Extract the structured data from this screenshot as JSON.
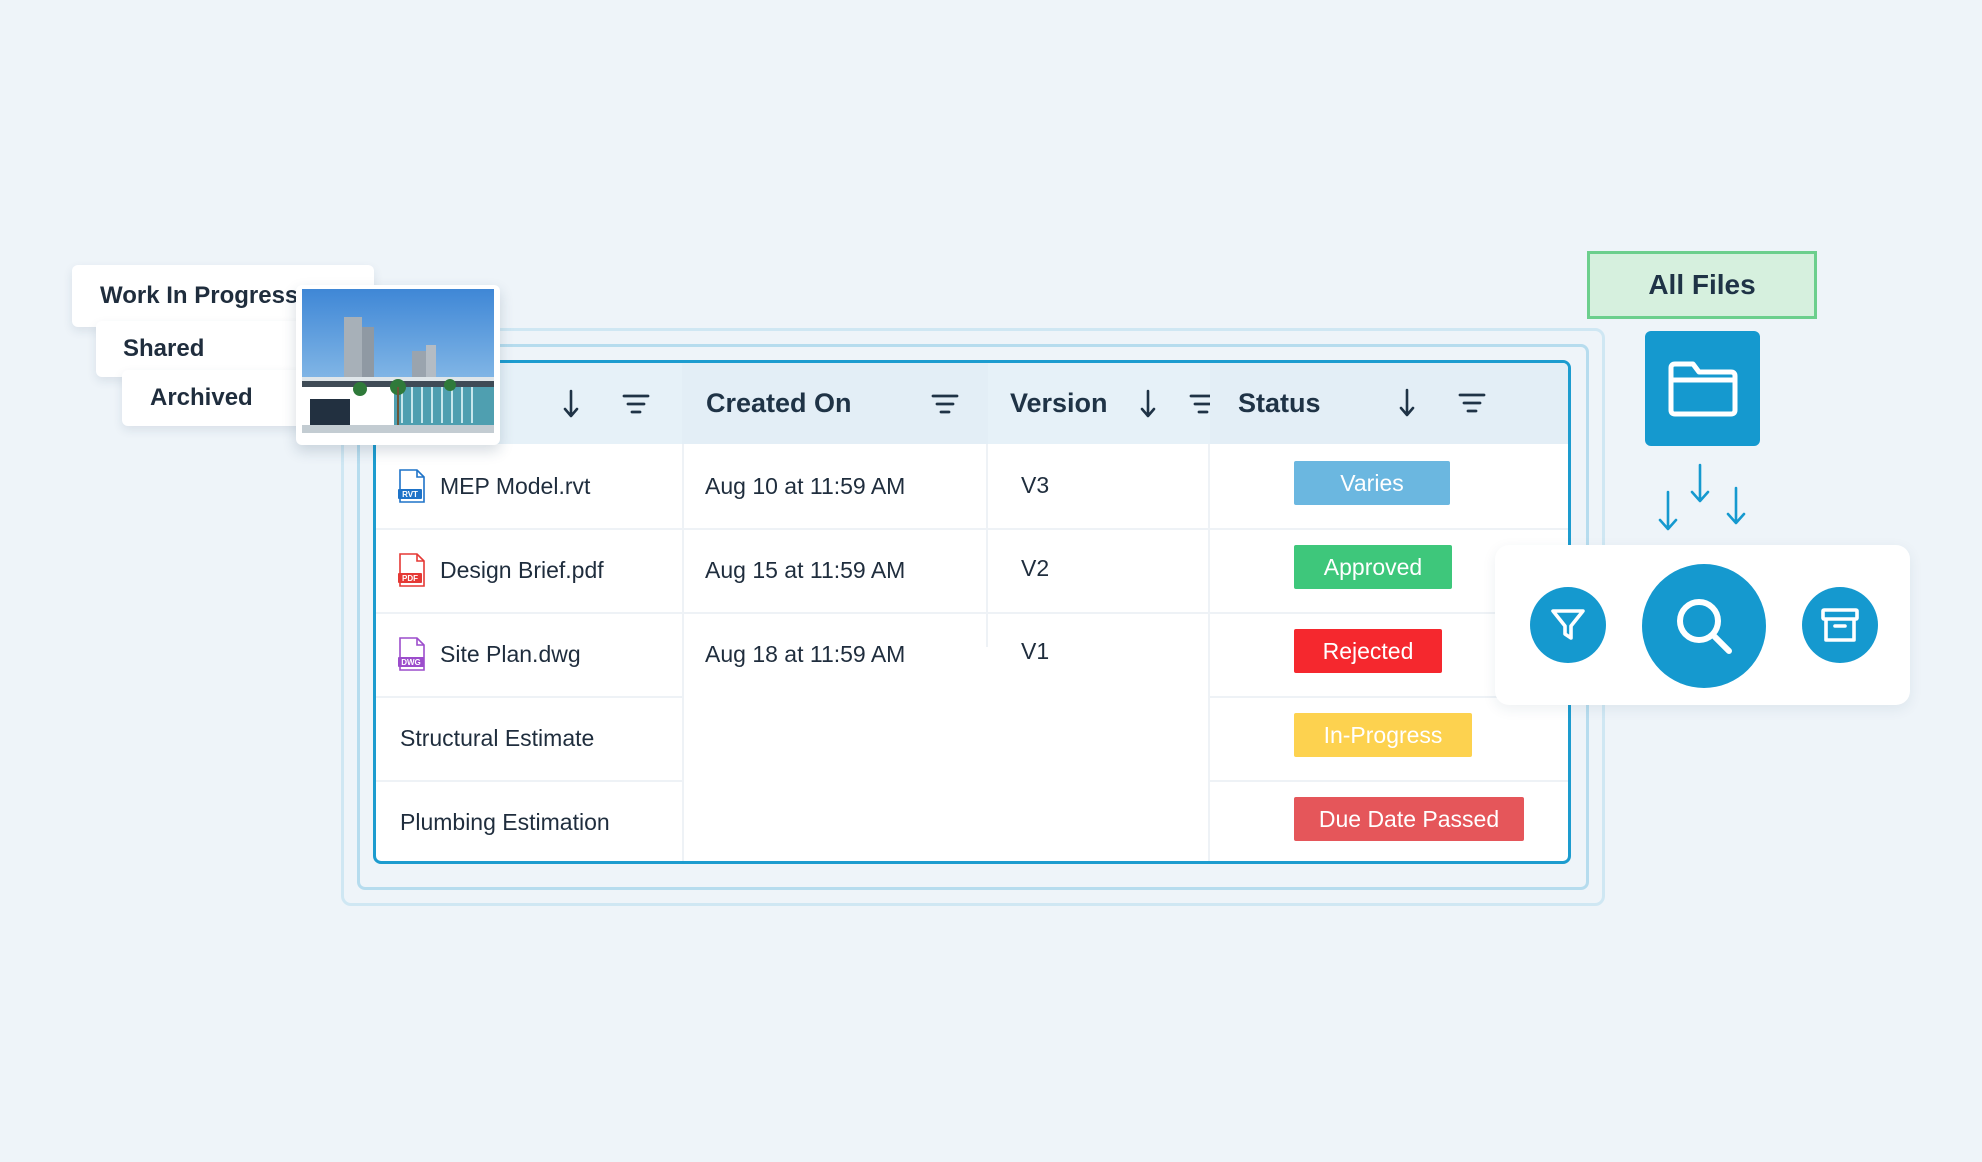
{
  "tabs": [
    "Work In Progress",
    "Shared",
    "Archived"
  ],
  "table": {
    "headers": {
      "created": "Created On",
      "version": "Version",
      "status": "Status"
    },
    "rows": [
      {
        "name": "MEP Model.rvt",
        "type": "RVT",
        "created": "Aug 10 at 11:59 AM",
        "version": "V3",
        "status": "Varies"
      },
      {
        "name": "Design Brief.pdf",
        "type": "PDF",
        "created": "Aug 15 at 11:59 AM",
        "version": "V2",
        "status": "Approved"
      },
      {
        "name": "Site Plan.dwg",
        "type": "DWG",
        "created": "Aug 18 at 11:59 AM",
        "version": "V1",
        "status": "Rejected"
      },
      {
        "name": "Structural Estimate",
        "status": "In-Progress"
      },
      {
        "name": "Plumbing Estimation",
        "status": "Due Date Passed"
      }
    ]
  },
  "status_colors": {
    "Varies": "#6bb7e0",
    "Approved": "#3ec77b",
    "Rejected": "#f5282e",
    "In-Progress": "#fdd24f",
    "Due Date Passed": "#e5565a"
  },
  "file_type_colors": {
    "RVT": "#1e73c8",
    "PDF": "#e53935",
    "DWG": "#9c4dcc"
  },
  "widgets": {
    "all_files_label": "All Files",
    "icons": [
      "folder-icon",
      "filter-icon",
      "search-icon",
      "archive-icon"
    ]
  },
  "accent": "#1599cf"
}
